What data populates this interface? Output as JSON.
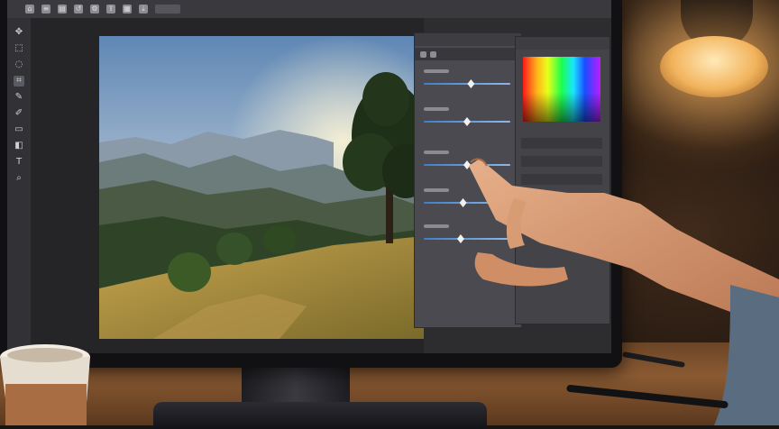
{
  "scene": {
    "subject": "photo-editing-touchscreen",
    "accent_color": "#3f7fc9",
    "lamp_color": "#f2b35c"
  },
  "editor": {
    "toolbar_icons": [
      "move-icon",
      "marquee-icon",
      "lasso-icon",
      "crop-icon",
      "eyedropper-icon",
      "brush-icon",
      "eraser-icon",
      "gradient-icon",
      "text-icon",
      "zoom-icon"
    ],
    "adjustment_panel": {
      "sliders": [
        {
          "level": 0.55
        },
        {
          "level": 0.5
        },
        {
          "level": 0.5
        },
        {
          "level": 0.45
        },
        {
          "level": 0.42
        }
      ]
    }
  }
}
